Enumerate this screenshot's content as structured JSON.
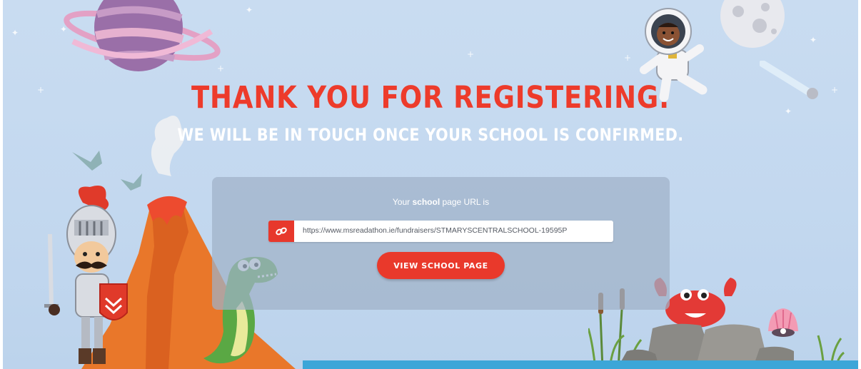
{
  "headline": "THANK YOU FOR REGISTERING.",
  "subheadline": "WE WILL BE IN TOUCH ONCE YOUR SCHOOL IS CONFIRMED.",
  "url_panel": {
    "caption_prefix": "Your",
    "caption_bold": "school",
    "caption_suffix": "page URL is",
    "url_value": "https://www.msreadathon.ie/fundraisers/STMARYSCENTRALSCHOOL-19595P",
    "link_icon": "link-icon",
    "button_label": "VIEW SCHOOL PAGE"
  },
  "colors": {
    "background": "#c6daf0",
    "accent_red": "#ed3b2b",
    "panel": "#a0b2c8",
    "text_white": "#ffffff"
  },
  "illustrations": [
    "planet",
    "astronaut",
    "moon",
    "comet",
    "volcano",
    "pterodactyls",
    "knight",
    "dinosaur",
    "crab",
    "rocks",
    "seashell",
    "reeds",
    "water"
  ]
}
